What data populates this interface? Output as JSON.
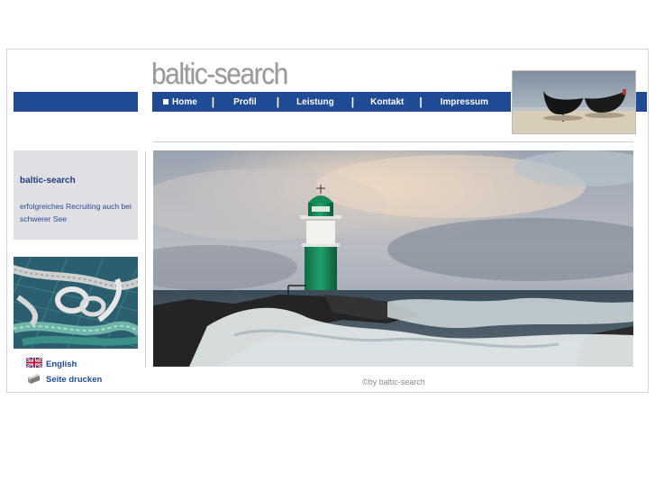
{
  "logo": "baltic-search",
  "nav": {
    "items": [
      {
        "label": "Home",
        "active": true
      },
      {
        "label": "Profil"
      },
      {
        "label": "Leistung"
      },
      {
        "label": "Kontakt"
      },
      {
        "label": "Impressum"
      }
    ],
    "separator": "|"
  },
  "sidebar": {
    "box_title": "baltic-search",
    "box_text": "erfolgreiches Recruiting auch bei schwerer See",
    "english_label": "English",
    "print_label": "Seite drucken"
  },
  "footer": {
    "copyright": "©by baltic-search"
  },
  "colors": {
    "brand_blue": "#1f4a94",
    "text_blue": "#2a4c90",
    "info_box_bg": "#e0e0e4"
  },
  "icons": [
    "uk-flag-icon",
    "printer-icon",
    "home-bullet-icon"
  ]
}
